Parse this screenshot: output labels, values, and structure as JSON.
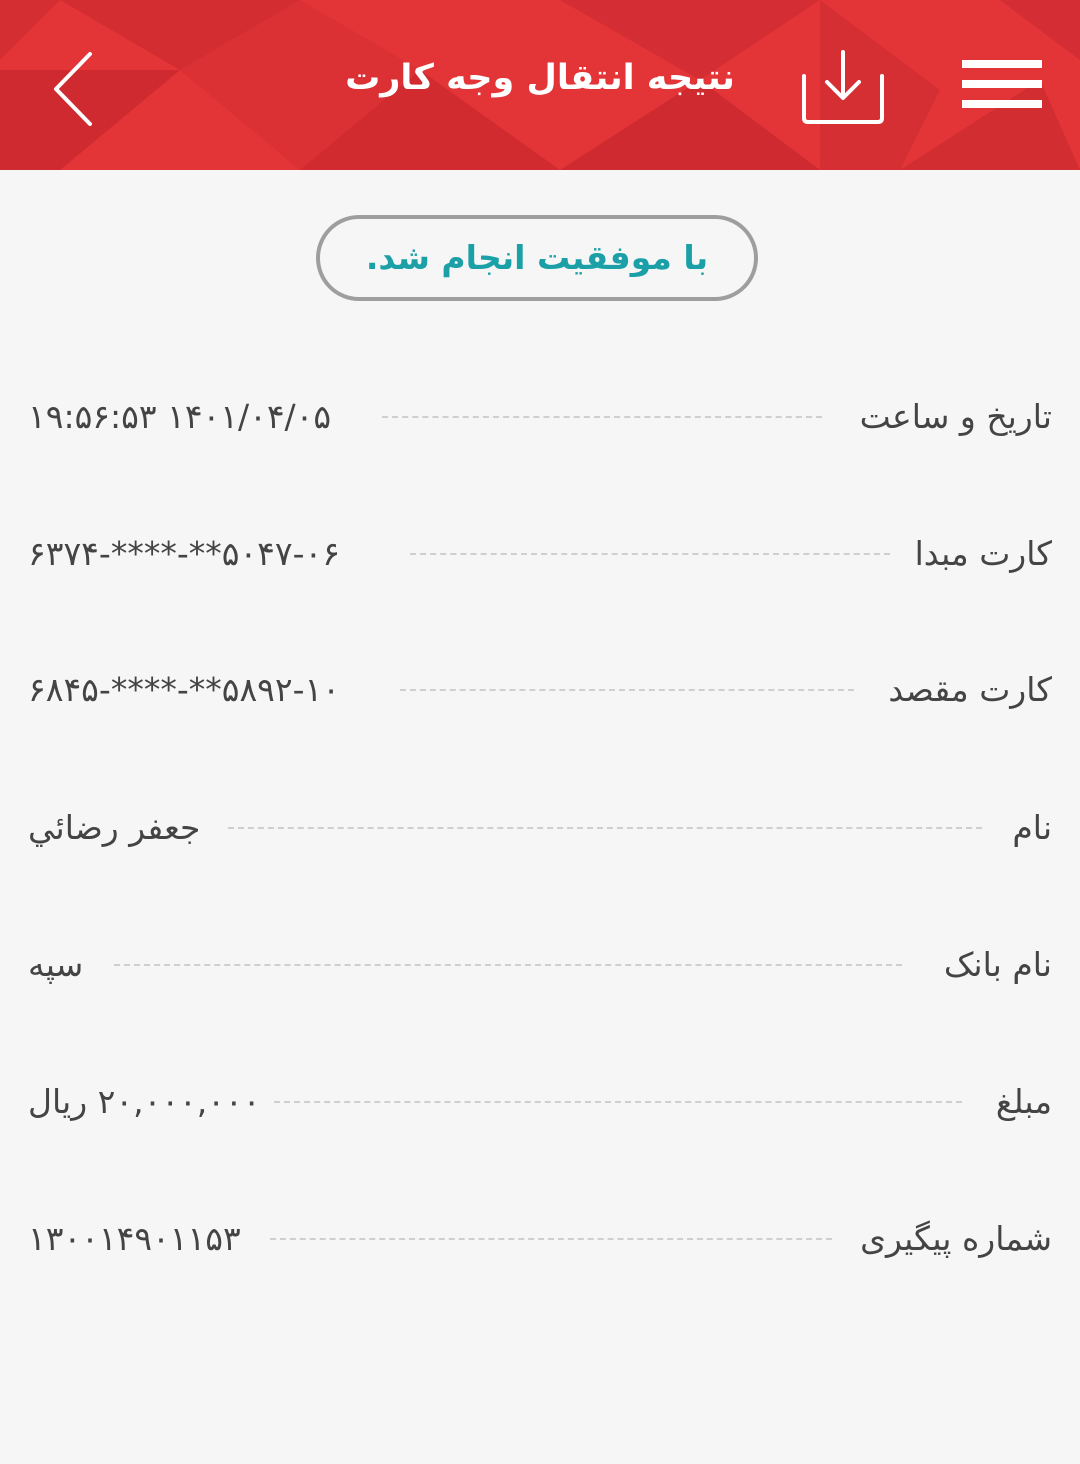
{
  "header": {
    "title": "نتیجه انتقال وجه کارت",
    "background_color": "#e33437",
    "icons": {
      "back": "chevron-left-icon",
      "download": "download-icon",
      "menu": "hamburger-menu-icon"
    }
  },
  "status": {
    "text": "با موفقیت انجام شد.",
    "color": "#1aa0a6"
  },
  "details": [
    {
      "label": "تاریخ و ساعت",
      "value": "۱۴۰۱/۰۴/۰۵ ۱۹:۵۶:۵۳"
    },
    {
      "label": "کارت مبدا",
      "value": "۵۰۴۷-۰۶**-****-۶۳۷۴"
    },
    {
      "label": "کارت مقصد",
      "value": "۵۸۹۲-۱۰**-****-۶۸۴۵"
    },
    {
      "label": "نام",
      "value": "جعفر رضائي"
    },
    {
      "label": "نام بانک",
      "value": "سپه"
    },
    {
      "label": "مبلغ",
      "value": "۲۰,۰۰۰,۰۰۰ ریال"
    },
    {
      "label": "شماره پیگیری",
      "value": "۱۳۰۰۱۴۹۰۱۱۵۳"
    }
  ]
}
